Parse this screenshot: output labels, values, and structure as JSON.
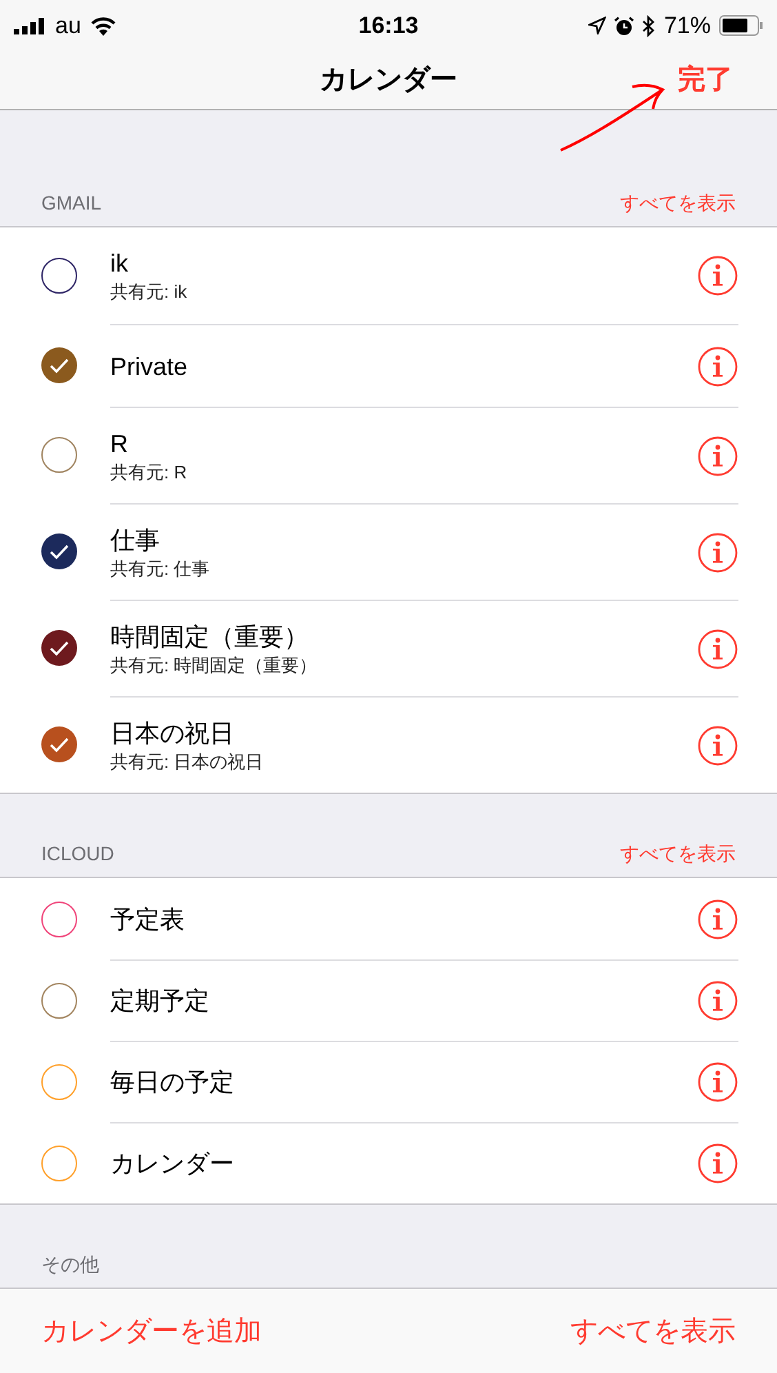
{
  "status_bar": {
    "carrier": "au",
    "time": "16:13",
    "battery": "71%"
  },
  "nav": {
    "title": "カレンダー",
    "done": "完了"
  },
  "sections": [
    {
      "title": "GMAIL",
      "show_all": "すべてを表示",
      "calendars": [
        {
          "name": "ik",
          "subtitle": "共有元: ik",
          "checked": false,
          "color": "#2e2566"
        },
        {
          "name": "Private",
          "checked": true,
          "color": "#8b5a1e"
        },
        {
          "name": "R",
          "subtitle": "共有元: R",
          "checked": false,
          "color": "#a08460"
        },
        {
          "name": "仕事",
          "subtitle": "共有元: 仕事",
          "checked": true,
          "color": "#1c2a5c"
        },
        {
          "name": "時間固定（重要）",
          "subtitle": "共有元: 時間固定（重要）",
          "checked": true,
          "color": "#6e1a1e"
        },
        {
          "name": "日本の祝日",
          "subtitle": "共有元: 日本の祝日",
          "checked": true,
          "color": "#b8501e"
        }
      ]
    },
    {
      "title": "ICLOUD",
      "show_all": "すべてを表示",
      "calendars": [
        {
          "name": "予定表",
          "checked": false,
          "color": "#f0447a"
        },
        {
          "name": "定期予定",
          "checked": false,
          "color": "#a2845e"
        },
        {
          "name": "毎日の予定",
          "checked": false,
          "color": "#ffa02a"
        },
        {
          "name": "カレンダー",
          "checked": false,
          "color": "#ffa02a"
        }
      ]
    },
    {
      "title": "その他"
    }
  ],
  "toolbar": {
    "add": "カレンダーを追加",
    "show_all": "すべてを表示"
  }
}
